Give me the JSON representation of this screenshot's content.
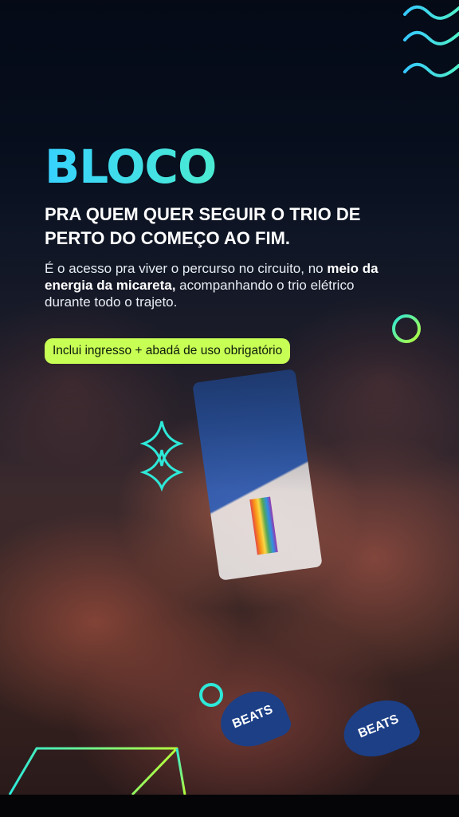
{
  "hero": {
    "title": "BLOCO",
    "headline_line1": "PRA QUEM QUER SEGUIR O TRIO DE",
    "headline_line2": "PERTO DO COMEÇO AO FIM.",
    "body": {
      "part1": "É o acesso pra viver o percurso no circuito, no",
      "part2_bold": "meio da energia da micareta,",
      "part3": " acompanhando o trio elétrico durante todo o trajeto."
    },
    "badge": "Inclui ingresso + abadá de uso obrigatório"
  },
  "photo": {
    "fan_text": "BEATS"
  },
  "colors": {
    "gradient_start": "#37d2ff",
    "gradient_end": "#a8ff3e",
    "badge_bg": "#c8ff55",
    "accent_cyan": "#2ee8d8",
    "accent_lime": "#b6ff3a"
  },
  "icons": {
    "top_right": "wave-lines-icon",
    "mid_right": "ring-icon",
    "left": "diamond-sparkle-icon",
    "bottom": "ring-icon",
    "bottom_left": "triangle-outline-icon"
  }
}
